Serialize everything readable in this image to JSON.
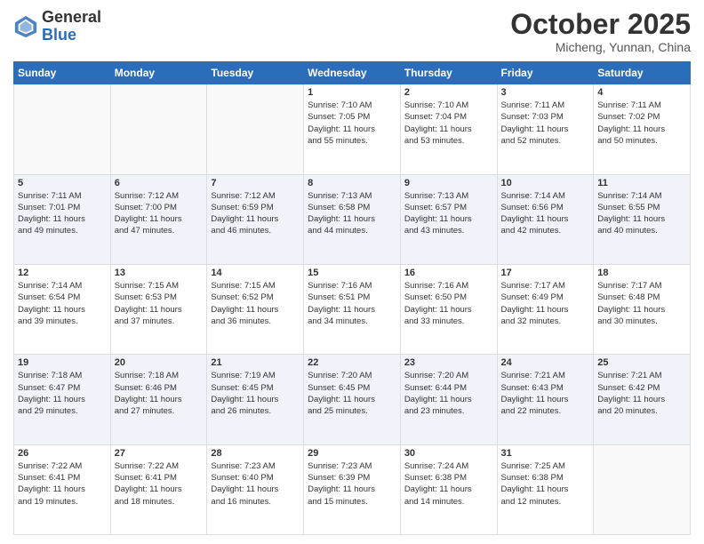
{
  "logo": {
    "text_general": "General",
    "text_blue": "Blue"
  },
  "header": {
    "month_title": "October 2025",
    "location": "Micheng, Yunnan, China"
  },
  "days_of_week": [
    "Sunday",
    "Monday",
    "Tuesday",
    "Wednesday",
    "Thursday",
    "Friday",
    "Saturday"
  ],
  "weeks": [
    [
      {
        "day": "",
        "info": ""
      },
      {
        "day": "",
        "info": ""
      },
      {
        "day": "",
        "info": ""
      },
      {
        "day": "1",
        "info": "Sunrise: 7:10 AM\nSunset: 7:05 PM\nDaylight: 11 hours\nand 55 minutes."
      },
      {
        "day": "2",
        "info": "Sunrise: 7:10 AM\nSunset: 7:04 PM\nDaylight: 11 hours\nand 53 minutes."
      },
      {
        "day": "3",
        "info": "Sunrise: 7:11 AM\nSunset: 7:03 PM\nDaylight: 11 hours\nand 52 minutes."
      },
      {
        "day": "4",
        "info": "Sunrise: 7:11 AM\nSunset: 7:02 PM\nDaylight: 11 hours\nand 50 minutes."
      }
    ],
    [
      {
        "day": "5",
        "info": "Sunrise: 7:11 AM\nSunset: 7:01 PM\nDaylight: 11 hours\nand 49 minutes."
      },
      {
        "day": "6",
        "info": "Sunrise: 7:12 AM\nSunset: 7:00 PM\nDaylight: 11 hours\nand 47 minutes."
      },
      {
        "day": "7",
        "info": "Sunrise: 7:12 AM\nSunset: 6:59 PM\nDaylight: 11 hours\nand 46 minutes."
      },
      {
        "day": "8",
        "info": "Sunrise: 7:13 AM\nSunset: 6:58 PM\nDaylight: 11 hours\nand 44 minutes."
      },
      {
        "day": "9",
        "info": "Sunrise: 7:13 AM\nSunset: 6:57 PM\nDaylight: 11 hours\nand 43 minutes."
      },
      {
        "day": "10",
        "info": "Sunrise: 7:14 AM\nSunset: 6:56 PM\nDaylight: 11 hours\nand 42 minutes."
      },
      {
        "day": "11",
        "info": "Sunrise: 7:14 AM\nSunset: 6:55 PM\nDaylight: 11 hours\nand 40 minutes."
      }
    ],
    [
      {
        "day": "12",
        "info": "Sunrise: 7:14 AM\nSunset: 6:54 PM\nDaylight: 11 hours\nand 39 minutes."
      },
      {
        "day": "13",
        "info": "Sunrise: 7:15 AM\nSunset: 6:53 PM\nDaylight: 11 hours\nand 37 minutes."
      },
      {
        "day": "14",
        "info": "Sunrise: 7:15 AM\nSunset: 6:52 PM\nDaylight: 11 hours\nand 36 minutes."
      },
      {
        "day": "15",
        "info": "Sunrise: 7:16 AM\nSunset: 6:51 PM\nDaylight: 11 hours\nand 34 minutes."
      },
      {
        "day": "16",
        "info": "Sunrise: 7:16 AM\nSunset: 6:50 PM\nDaylight: 11 hours\nand 33 minutes."
      },
      {
        "day": "17",
        "info": "Sunrise: 7:17 AM\nSunset: 6:49 PM\nDaylight: 11 hours\nand 32 minutes."
      },
      {
        "day": "18",
        "info": "Sunrise: 7:17 AM\nSunset: 6:48 PM\nDaylight: 11 hours\nand 30 minutes."
      }
    ],
    [
      {
        "day": "19",
        "info": "Sunrise: 7:18 AM\nSunset: 6:47 PM\nDaylight: 11 hours\nand 29 minutes."
      },
      {
        "day": "20",
        "info": "Sunrise: 7:18 AM\nSunset: 6:46 PM\nDaylight: 11 hours\nand 27 minutes."
      },
      {
        "day": "21",
        "info": "Sunrise: 7:19 AM\nSunset: 6:45 PM\nDaylight: 11 hours\nand 26 minutes."
      },
      {
        "day": "22",
        "info": "Sunrise: 7:20 AM\nSunset: 6:45 PM\nDaylight: 11 hours\nand 25 minutes."
      },
      {
        "day": "23",
        "info": "Sunrise: 7:20 AM\nSunset: 6:44 PM\nDaylight: 11 hours\nand 23 minutes."
      },
      {
        "day": "24",
        "info": "Sunrise: 7:21 AM\nSunset: 6:43 PM\nDaylight: 11 hours\nand 22 minutes."
      },
      {
        "day": "25",
        "info": "Sunrise: 7:21 AM\nSunset: 6:42 PM\nDaylight: 11 hours\nand 20 minutes."
      }
    ],
    [
      {
        "day": "26",
        "info": "Sunrise: 7:22 AM\nSunset: 6:41 PM\nDaylight: 11 hours\nand 19 minutes."
      },
      {
        "day": "27",
        "info": "Sunrise: 7:22 AM\nSunset: 6:41 PM\nDaylight: 11 hours\nand 18 minutes."
      },
      {
        "day": "28",
        "info": "Sunrise: 7:23 AM\nSunset: 6:40 PM\nDaylight: 11 hours\nand 16 minutes."
      },
      {
        "day": "29",
        "info": "Sunrise: 7:23 AM\nSunset: 6:39 PM\nDaylight: 11 hours\nand 15 minutes."
      },
      {
        "day": "30",
        "info": "Sunrise: 7:24 AM\nSunset: 6:38 PM\nDaylight: 11 hours\nand 14 minutes."
      },
      {
        "day": "31",
        "info": "Sunrise: 7:25 AM\nSunset: 6:38 PM\nDaylight: 11 hours\nand 12 minutes."
      },
      {
        "day": "",
        "info": ""
      }
    ]
  ]
}
